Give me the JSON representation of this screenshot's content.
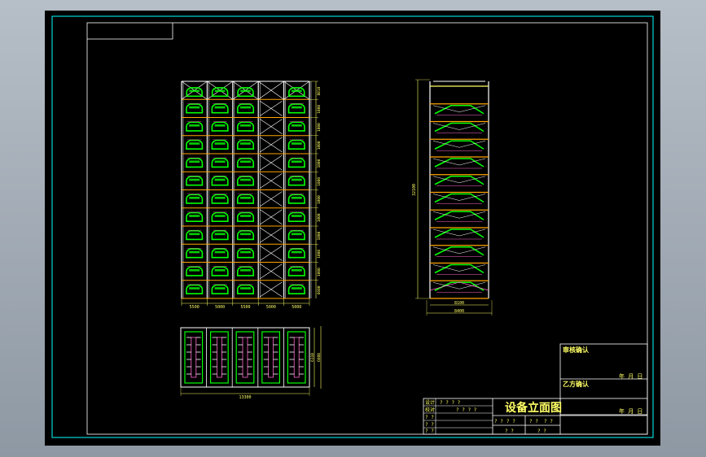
{
  "colors": {
    "background": "#000000",
    "frame": "#00ffff",
    "structure": "#ffffff",
    "beam": "#ffa500",
    "car": "#00ff00",
    "bracing": "#ff66cc",
    "dimension": "#ffff66",
    "window_bg": "#a7b0ba"
  },
  "front_view": {
    "bay_dims": [
      "5500",
      "5000",
      "5500",
      "5000",
      "5000"
    ],
    "level_dims": [
      "8818",
      "1800",
      "1800",
      "1800",
      "1800",
      "1800",
      "1800",
      "1800",
      "1800",
      "1800",
      "1800",
      "6600"
    ]
  },
  "side_view": {
    "height_dim": "32100",
    "inner_width_dim": "8100",
    "outer_width_dim": "8400"
  },
  "plan_view": {
    "width_dim": "13300",
    "depth_dims": [
      "6110",
      "6600"
    ]
  },
  "title_block": {
    "title": "设备立面图",
    "sign_a": "审核确认",
    "sign_b": "乙方确认",
    "date_a": "年 月 日",
    "date_b": "年 月 日",
    "row_labels": [
      "设计",
      "校对",
      "? ?",
      "? ?",
      "? ?"
    ],
    "row_values": [
      "? ? ? ?",
      "? ? ? ?",
      "? ?",
      "? ?"
    ],
    "scale_label": "? ?",
    "scale_value": "? ?",
    "sheet_label": "? ?",
    "sheet_value": "? ?"
  }
}
